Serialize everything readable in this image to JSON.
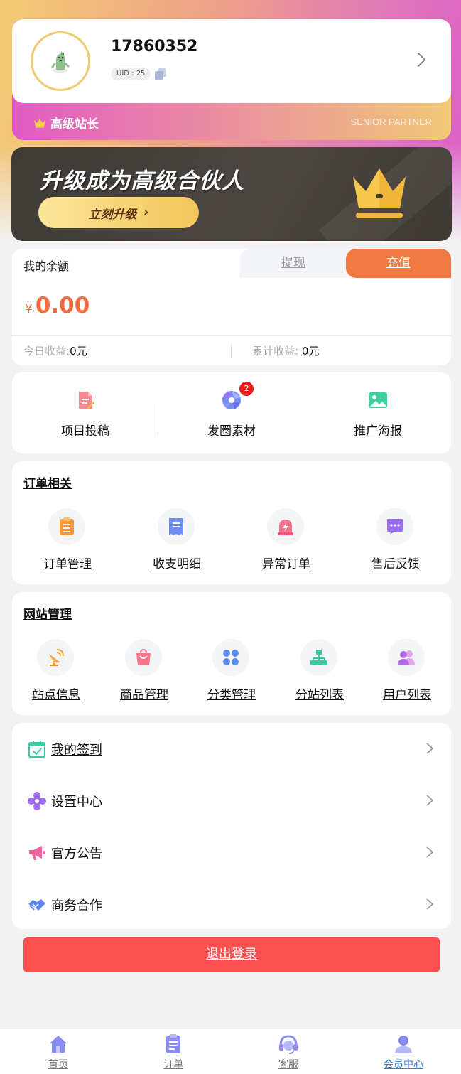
{
  "profile": {
    "username": "17860352",
    "uid_label": "UID : 25"
  },
  "membership": {
    "level": "高级站长",
    "level_en": "SENIOR PARTNER"
  },
  "promo": {
    "title": "升级成为高级合伙人",
    "button": "立刻升级",
    "button_arrow": "›"
  },
  "balance": {
    "title": "我的余额",
    "withdraw": "提现",
    "recharge": "充值",
    "currency": "¥",
    "amount": "0.00",
    "today_label": "今日收益:",
    "today_value": "0元",
    "total_label": "累计收益: ",
    "total_value": "0元"
  },
  "quick_actions": [
    {
      "label": "项目投稿",
      "icon": "document-edit-icon"
    },
    {
      "label": "发圈素材",
      "icon": "aperture-icon",
      "badge": "2"
    },
    {
      "label": "推广海报",
      "icon": "image-icon"
    }
  ],
  "orders": {
    "title": "订单相关",
    "items": [
      {
        "label": "订单管理",
        "icon": "order-list-icon"
      },
      {
        "label": "收支明细",
        "icon": "receipt-icon"
      },
      {
        "label": "异常订单",
        "icon": "alarm-icon"
      },
      {
        "label": "售后反馈",
        "icon": "chat-icon"
      }
    ]
  },
  "site": {
    "title": "网站管理",
    "items": [
      {
        "label": "站点信息",
        "icon": "satellite-icon"
      },
      {
        "label": "商品管理",
        "icon": "shopping-bag-icon"
      },
      {
        "label": "分类管理",
        "icon": "category-grid-icon"
      },
      {
        "label": "分站列表",
        "icon": "sitemap-icon"
      },
      {
        "label": "用户列表",
        "icon": "users-icon"
      }
    ]
  },
  "menu": [
    {
      "label": "我的签到",
      "icon": "calendar-check-icon"
    },
    {
      "label": "设置中心",
      "icon": "flower-settings-icon"
    },
    {
      "label": "官方公告",
      "icon": "megaphone-icon"
    },
    {
      "label": "商务合作",
      "icon": "handshake-icon"
    }
  ],
  "logout": "退出登录",
  "bottom_nav": [
    {
      "label": "首页",
      "icon": "home-icon"
    },
    {
      "label": "订单",
      "icon": "clipboard-icon"
    },
    {
      "label": "客服",
      "icon": "headset-icon"
    },
    {
      "label": "会员中心",
      "icon": "user-icon",
      "active": true
    }
  ],
  "colors": {
    "accent_orange": "#ef7a44",
    "amount_orange": "#f06a3d",
    "logout_red": "#fb5050",
    "nav_active_blue": "#2d7cf6",
    "gold": "#f3c65a"
  }
}
